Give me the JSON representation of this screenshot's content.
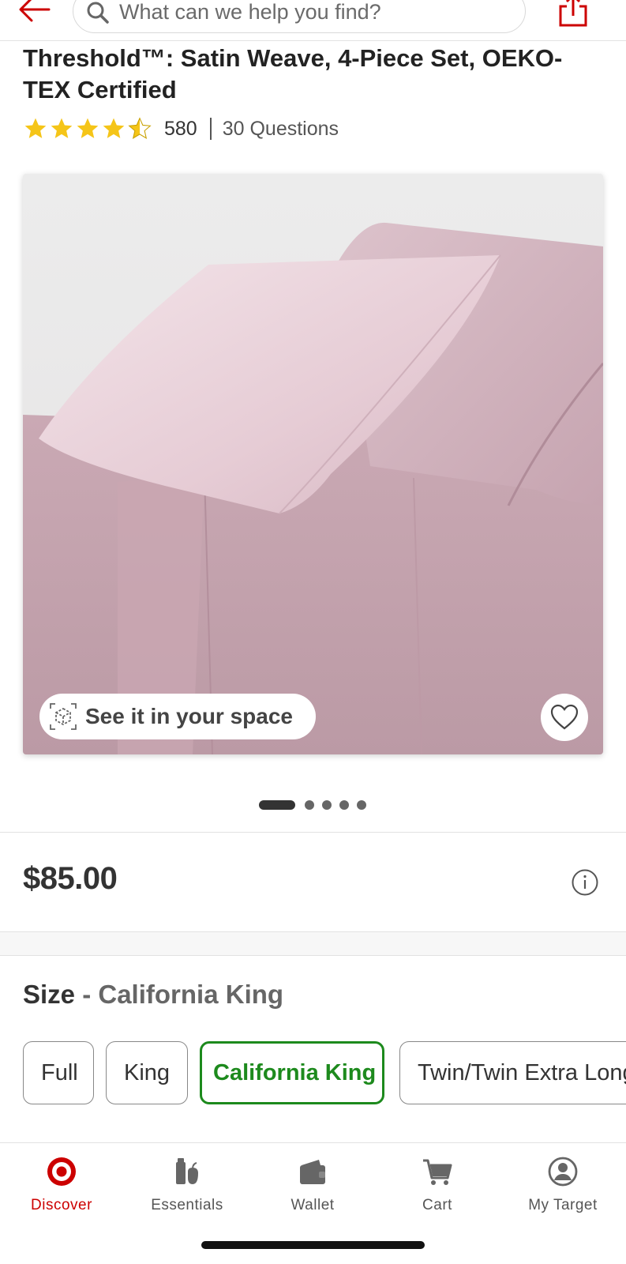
{
  "search": {
    "placeholder": "What can we help you find?"
  },
  "product": {
    "title": "Threshold™: Satin Weave, 4-Piece Set, OEKO-TEX Certified",
    "rating_stars": 4.5,
    "rating_count": "580",
    "questions_label": "30 Questions",
    "see_in_space_label": "See it in your space",
    "carousel": {
      "total": 5,
      "active": 1
    },
    "price": "$85.00"
  },
  "size": {
    "label": "Size",
    "separator": " - ",
    "selected": "California King",
    "options": [
      "Full",
      "King",
      "California King",
      "Twin/Twin Extra Long"
    ]
  },
  "bottom_nav": {
    "items": [
      {
        "label": "Discover",
        "icon": "target-bullseye-icon",
        "active": true
      },
      {
        "label": "Essentials",
        "icon": "essentials-icon",
        "active": false
      },
      {
        "label": "Wallet",
        "icon": "wallet-icon",
        "active": false
      },
      {
        "label": "Cart",
        "icon": "cart-icon",
        "active": false
      },
      {
        "label": "My Target",
        "icon": "account-icon",
        "active": false
      }
    ]
  },
  "colors": {
    "brand_red": "#cc0000",
    "selected_green": "#1d8a1d",
    "star_gold": "#f5c518",
    "text_dark": "#333333"
  }
}
